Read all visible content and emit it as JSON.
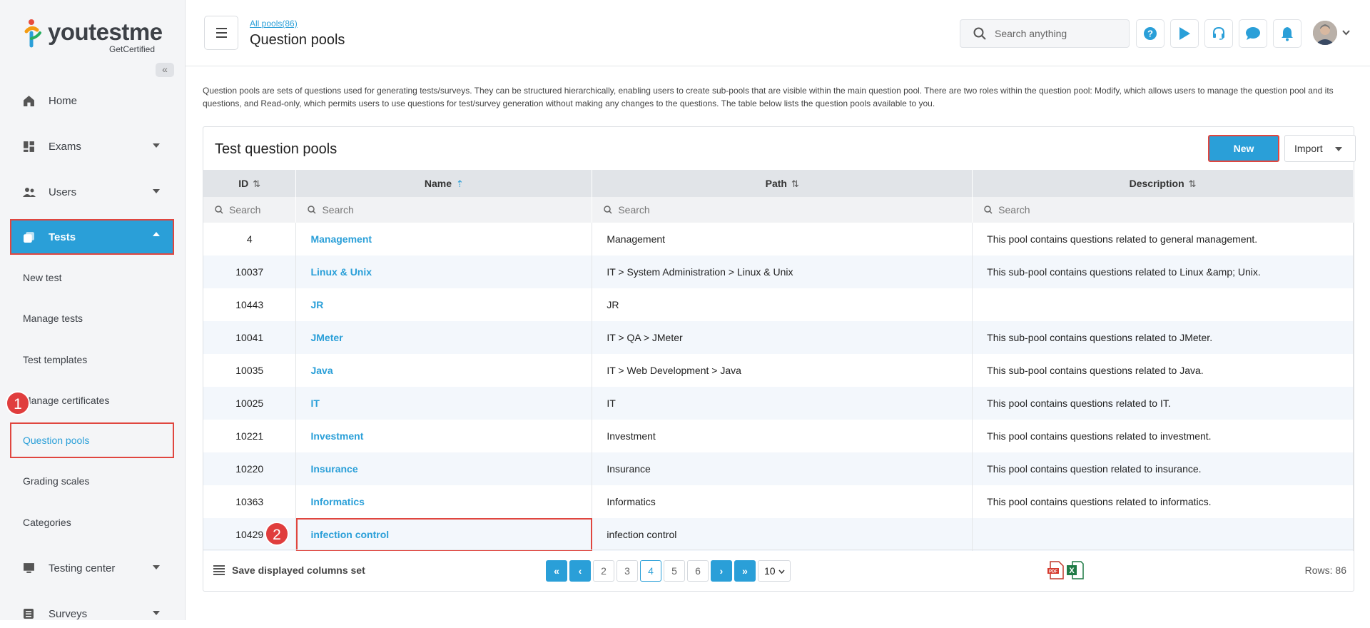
{
  "brand": {
    "name": "youtestme",
    "sub": "GetCertified"
  },
  "sidebar": {
    "collapse_glyph": "«",
    "items": [
      {
        "label": "Home",
        "icon": "home-icon"
      },
      {
        "label": "Exams",
        "icon": "dashboard-icon"
      },
      {
        "label": "Users",
        "icon": "users-icon"
      },
      {
        "label": "Tests",
        "icon": "tests-icon"
      },
      {
        "label": "Testing center",
        "icon": "monitor-icon"
      },
      {
        "label": "Surveys",
        "icon": "list-icon"
      }
    ],
    "sub_items": [
      "New test",
      "Manage tests",
      "Test templates",
      "Manage certificates",
      "Question pools",
      "Grading scales",
      "Categories"
    ]
  },
  "annotations": {
    "step1": "1",
    "step2": "2"
  },
  "header": {
    "breadcrumb": "All pools(86)",
    "title": "Question pools",
    "search_placeholder": "Search anything"
  },
  "intro": "Question pools are sets of questions used for generating tests/surveys. They can be structured hierarchically, enabling users to create sub-pools that are visible within the main question pool. There are two roles within the question pool: Modify, which allows users to manage the question pool and its questions, and Read-only, which permits users to use questions for test/survey generation without making any changes to the questions. The table below lists the question pools available to you.",
  "card": {
    "title": "Test question pools",
    "new_label": "New",
    "import_label": "Import"
  },
  "table": {
    "columns": [
      "ID",
      "Name",
      "Path",
      "Description"
    ],
    "filter_placeholder": "Search",
    "rows": [
      {
        "id": "4",
        "name": "Management",
        "path": "Management",
        "desc": "This pool contains questions related to general management."
      },
      {
        "id": "10037",
        "name": "Linux & Unix",
        "path": "IT > System Administration > Linux & Unix",
        "desc": "This sub-pool contains questions related to Linux &amp; Unix."
      },
      {
        "id": "10443",
        "name": "JR",
        "path": "JR",
        "desc": ""
      },
      {
        "id": "10041",
        "name": "JMeter",
        "path": "IT > QA > JMeter",
        "desc": "This sub-pool contains questions related to JMeter."
      },
      {
        "id": "10035",
        "name": "Java",
        "path": "IT > Web Development > Java",
        "desc": "This sub-pool contains questions related to Java."
      },
      {
        "id": "10025",
        "name": "IT",
        "path": "IT",
        "desc": "This pool contains questions related to IT."
      },
      {
        "id": "10221",
        "name": "Investment",
        "path": "Investment",
        "desc": "This pool contains questions related to investment."
      },
      {
        "id": "10220",
        "name": "Insurance",
        "path": "Insurance",
        "desc": "This pool contains question related to insurance."
      },
      {
        "id": "10363",
        "name": "Informatics",
        "path": "Informatics",
        "desc": "This pool contains questions related to informatics."
      },
      {
        "id": "10429",
        "name": "infection control",
        "path": "infection control",
        "desc": ""
      }
    ]
  },
  "footer": {
    "save_label": "Save displayed columns set",
    "pages": [
      "2",
      "3",
      "4",
      "5",
      "6"
    ],
    "current_page": "4",
    "rows_per_page": "10",
    "rows_count": "Rows: 86"
  },
  "colors": {
    "accent": "#2a9fd8",
    "highlight": "#e0463f"
  }
}
